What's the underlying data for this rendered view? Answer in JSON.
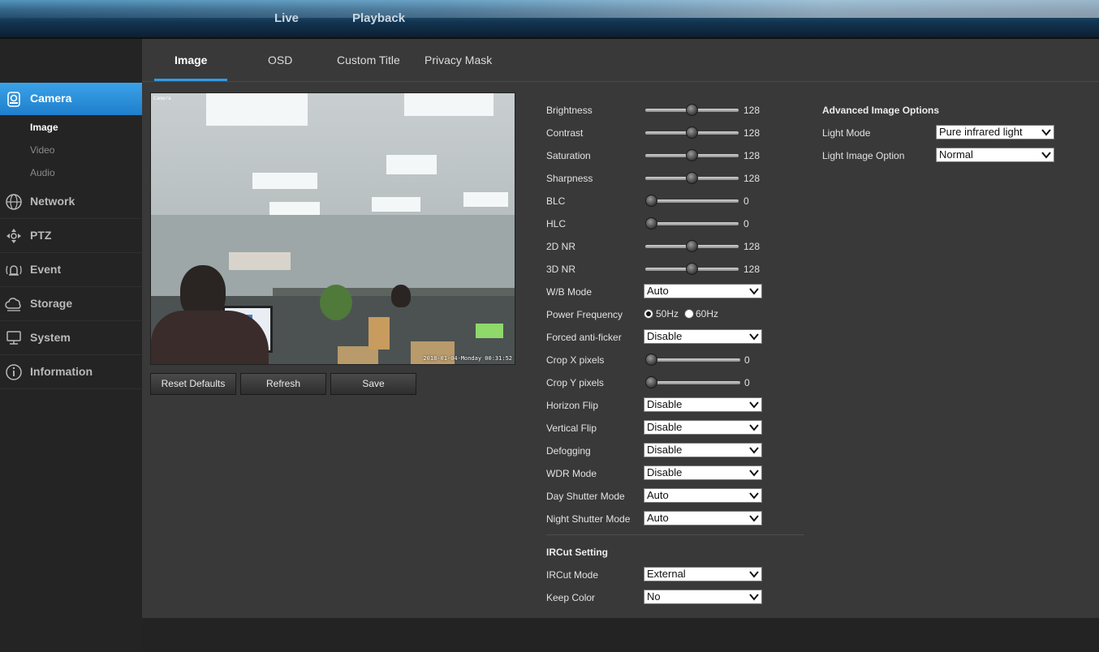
{
  "topnav": {
    "live": "Live",
    "playback": "Playback"
  },
  "sidebar": {
    "items": [
      {
        "key": "camera",
        "label": "Camera",
        "icon": "camera-icon"
      },
      {
        "key": "network",
        "label": "Network",
        "icon": "globe-icon"
      },
      {
        "key": "ptz",
        "label": "PTZ",
        "icon": "ptz-icon"
      },
      {
        "key": "event",
        "label": "Event",
        "icon": "alarm-icon"
      },
      {
        "key": "storage",
        "label": "Storage",
        "icon": "cloud-icon"
      },
      {
        "key": "system",
        "label": "System",
        "icon": "monitor-icon"
      },
      {
        "key": "information",
        "label": "Information",
        "icon": "info-icon"
      }
    ],
    "camera_sub": [
      {
        "label": "Image",
        "active": true
      },
      {
        "label": "Video",
        "active": false
      },
      {
        "label": "Audio",
        "active": false
      }
    ]
  },
  "tabs": [
    {
      "label": "Image",
      "active": true
    },
    {
      "label": "OSD",
      "active": false
    },
    {
      "label": "Custom Title",
      "active": false
    },
    {
      "label": "Privacy Mask",
      "active": false
    }
  ],
  "video": {
    "channel_label": "Camera",
    "timestamp": "2018-01-04-Monday 00:31:52"
  },
  "buttons": {
    "reset": "Reset Defaults",
    "refresh": "Refresh",
    "save": "Save"
  },
  "sliders": [
    {
      "label": "Brightness",
      "value": "128",
      "level": 0.5
    },
    {
      "label": "Contrast",
      "value": "128",
      "level": 0.5
    },
    {
      "label": "Saturation",
      "value": "128",
      "level": 0.5
    },
    {
      "label": "Sharpness",
      "value": "128",
      "level": 0.5
    },
    {
      "label": "BLC",
      "value": "0",
      "level": 0
    },
    {
      "label": "HLC",
      "value": "0",
      "level": 0
    },
    {
      "label": "2D NR",
      "value": "128",
      "level": 0.5
    },
    {
      "label": "3D NR",
      "value": "128",
      "level": 0.5
    }
  ],
  "wb_mode": {
    "label": "W/B Mode",
    "value": "Auto"
  },
  "power_frequency": {
    "label": "Power Frequency",
    "options": [
      "50Hz",
      "60Hz"
    ],
    "selected": "50Hz"
  },
  "forced_antiflicker": {
    "label": "Forced anti-ficker",
    "value": "Disable"
  },
  "crop": [
    {
      "label": "Crop X pixels",
      "value": "0",
      "level": 0
    },
    {
      "label": "Crop Y pixels",
      "value": "0",
      "level": 0
    }
  ],
  "selects": [
    {
      "label": "Horizon Flip",
      "value": "Disable"
    },
    {
      "label": "Vertical Flip",
      "value": "Disable"
    },
    {
      "label": "Defogging",
      "value": "Disable"
    },
    {
      "label": "WDR Mode",
      "value": "Disable"
    },
    {
      "label": "Day Shutter Mode",
      "value": "Auto"
    },
    {
      "label": "Night Shutter Mode",
      "value": "Auto"
    }
  ],
  "ircut": {
    "title": "IRCut Setting",
    "mode": {
      "label": "IRCut Mode",
      "value": "External"
    },
    "keep_color": {
      "label": "Keep Color",
      "value": "No"
    }
  },
  "advanced": {
    "title": "Advanced Image Options",
    "light_mode": {
      "label": "Light Mode",
      "value": "Pure infrared light"
    },
    "light_image_option": {
      "label": "Light Image Option",
      "value": "Normal"
    }
  }
}
